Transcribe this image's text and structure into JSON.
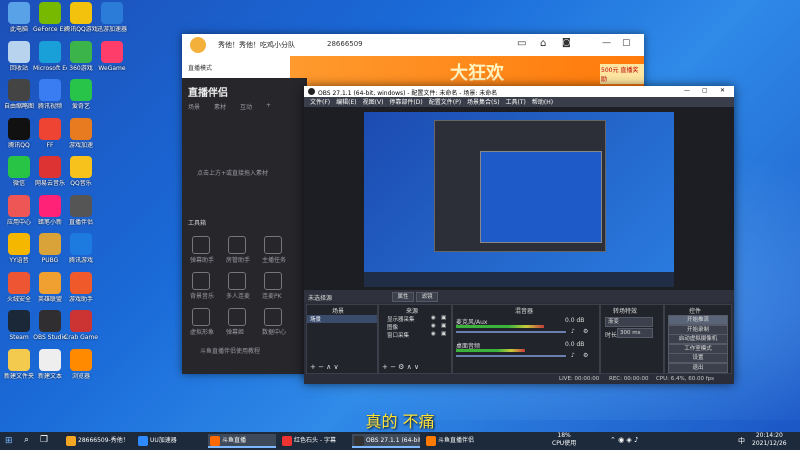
{
  "desktop_icons": [
    {
      "label": "此电脑",
      "color": "#5aa2e8",
      "col": 0,
      "row": 0
    },
    {
      "label": "GeForce Experience",
      "color": "#76b900",
      "col": 1,
      "row": 0
    },
    {
      "label": "腾讯QQ游戏",
      "color": "#f2c20c",
      "col": 2,
      "row": 0
    },
    {
      "label": "迅游加速器",
      "color": "#2b7bd8",
      "col": 3,
      "row": 0
    },
    {
      "label": "回收站",
      "color": "#b7d3ee",
      "col": 0,
      "row": 1
    },
    {
      "label": "Microsoft Edge",
      "color": "#1aa0d8",
      "col": 1,
      "row": 1
    },
    {
      "label": "360游戏",
      "color": "#3bb54a",
      "col": 2,
      "row": 1
    },
    {
      "label": "WeGame",
      "color": "#ff3d6a",
      "col": 3,
      "row": 1
    },
    {
      "label": "自由缩略图",
      "color": "#444",
      "col": 0,
      "row": 2
    },
    {
      "label": "腾讯视频",
      "color": "#3a7cf2",
      "col": 1,
      "row": 2
    },
    {
      "label": "爱奇艺",
      "color": "#28c44a",
      "col": 2,
      "row": 2
    },
    {
      "label": "腾讯QQ",
      "color": "#111",
      "col": 0,
      "row": 3
    },
    {
      "label": "FF",
      "color": "#e43",
      "col": 1,
      "row": 3
    },
    {
      "label": "游戏加速",
      "color": "#e87b20",
      "col": 2,
      "row": 3
    },
    {
      "label": "微信",
      "color": "#28c445",
      "col": 0,
      "row": 4
    },
    {
      "label": "网易云音乐",
      "color": "#d33",
      "col": 1,
      "row": 4
    },
    {
      "label": "QQ音乐",
      "color": "#f7c21b",
      "col": 2,
      "row": 4
    },
    {
      "label": "应用中心",
      "color": "#e55",
      "col": 0,
      "row": 5
    },
    {
      "label": "蜡笔小新",
      "color": "#f27",
      "col": 1,
      "row": 5
    },
    {
      "label": "直播伴侣",
      "color": "#555",
      "col": 2,
      "row": 5
    },
    {
      "label": "YY语音",
      "color": "#f5b700",
      "col": 0,
      "row": 6
    },
    {
      "label": "PUBG",
      "color": "#d9a33a",
      "col": 1,
      "row": 6
    },
    {
      "label": "腾讯游戏",
      "color": "#1d7be0",
      "col": 2,
      "row": 6
    },
    {
      "label": "火绒安全",
      "color": "#e53",
      "col": 0,
      "row": 7
    },
    {
      "label": "英雄联盟",
      "color": "#f0a030",
      "col": 1,
      "row": 7
    },
    {
      "label": "游戏助手",
      "color": "#f05a2a",
      "col": 2,
      "row": 7
    },
    {
      "label": "Steam",
      "color": "#1b2838",
      "col": 0,
      "row": 8
    },
    {
      "label": "OBS Studio",
      "color": "#302e31",
      "col": 1,
      "row": 8
    },
    {
      "label": "Crab Game",
      "color": "#c33",
      "col": 2,
      "row": 8
    },
    {
      "label": "新建文件夹",
      "color": "#f3c94e",
      "col": 0,
      "row": 9
    },
    {
      "label": "新建文本",
      "color": "#eee",
      "col": 1,
      "row": 9
    },
    {
      "label": "浏览器",
      "color": "#ff8a00",
      "col": 2,
      "row": 9
    }
  ],
  "live_app": {
    "title": "秀他！秀他！吃鸡小分队",
    "room_id": "28666509",
    "nav_label": "直播模式",
    "logo_text": "直播伴侣",
    "tabs": [
      "场景",
      "素材",
      "互动",
      "+"
    ],
    "empty_hint": "点击上方+或直接拖入素材",
    "tools_title": "工具箱",
    "tools": [
      "弹幕助手",
      "房管助手",
      "主播任务",
      "背景音乐",
      "多人连麦",
      "连麦PK",
      "虚拟形象",
      "弹幕姬",
      "数据中心"
    ],
    "footer_text": "斗鱼直播伴侣使用教程",
    "banner_text": "大狂欢",
    "banner_badge": "500元 直播奖励"
  },
  "obs": {
    "title": "OBS 27.1.1 (64-bit, windows) - 配置文件: 未命名 - 场景: 未命名",
    "menu": [
      "文件(F)",
      "编辑(E)",
      "视图(V)",
      "停靠部件(D)",
      "配置文件(P)",
      "场景集合(S)",
      "工具(T)",
      "帮助(H)"
    ],
    "no_source": "未选择源",
    "props_btn": "属性",
    "filter_btn": "滤镜",
    "docks": {
      "scenes": "场景",
      "sources": "来源",
      "mixer": "混音器",
      "transitions": "转场特效",
      "controls": "控件"
    },
    "scene_items": [
      "场景"
    ],
    "source_items": [
      "显示器采集",
      "图像",
      "窗口采集"
    ],
    "mixer": [
      {
        "name": "麦克风/Aux",
        "db": "0.0 dB",
        "level": 0.7
      },
      {
        "name": "桌面音频",
        "db": "0.0 dB",
        "level": 0.55
      }
    ],
    "transition": {
      "type": "渐变",
      "duration_label": "时长",
      "duration": "300 ms"
    },
    "controls": [
      "开始推流",
      "开始录制",
      "启动虚拟摄像机",
      "工作室模式",
      "设置",
      "退出"
    ],
    "status": {
      "live": "LIVE: 00:00:00",
      "rec": "REC: 00:00:00",
      "cpu": "CPU: 6.4%, 60.00 fps"
    }
  },
  "subtitle": "真的 不痛",
  "taskbar": {
    "items": [
      {
        "label": "28666509-秀他！",
        "color": "#f5a623",
        "active": false
      },
      {
        "label": "UU加速器",
        "color": "#2e8bff",
        "active": false
      },
      {
        "label": "斗鱼直播",
        "color": "#ff6a00",
        "active": true
      },
      {
        "label": "红色石头 - 字幕",
        "color": "#e33",
        "active": false
      },
      {
        "label": "OBS 27.1.1 (64-bit)",
        "color": "#333",
        "active": true
      },
      {
        "label": "斗鱼直播伴侣",
        "color": "#ff7a00",
        "active": false
      }
    ],
    "cpu_pct": "18%",
    "cpu_label": "CPU使用",
    "lang": "中",
    "time": "20:14:20",
    "date": "2021/12/26"
  },
  "accent": "#7cb7ff"
}
